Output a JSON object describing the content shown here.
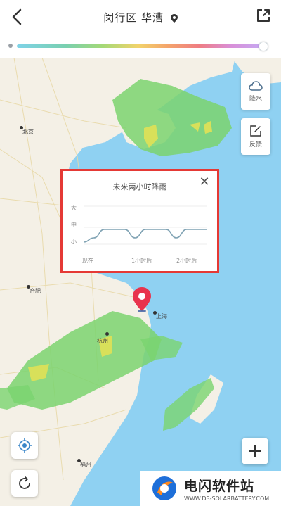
{
  "header": {
    "title": "闵行区 华漕",
    "back_icon": "chevron-left-icon",
    "share_icon": "share-icon",
    "location_icon": "location-pin-icon"
  },
  "timeline": {
    "handle_icon": "timeline-handle-icon"
  },
  "side_buttons": [
    {
      "label": "降水",
      "icon": "cloud-icon"
    },
    {
      "label": "反馈",
      "icon": "edit-icon"
    }
  ],
  "popup": {
    "title": "未来两小时降雨",
    "close_icon": "close-icon",
    "y_ticks": [
      "大",
      "中",
      "小"
    ],
    "x_ticks": [
      "现在",
      "1小时后",
      "2小时后"
    ]
  },
  "chart_data": {
    "type": "line",
    "title": "未来两小时降雨",
    "categories": [
      "现在",
      "1小时后",
      "2小时后"
    ],
    "y_categories": [
      "小",
      "中",
      "大"
    ],
    "x": [
      0,
      10,
      20,
      30,
      40,
      50,
      60,
      70,
      80,
      90,
      100,
      110,
      120
    ],
    "values": [
      0.15,
      0.25,
      0.45,
      0.45,
      0.45,
      0.25,
      0.45,
      0.45,
      0.45,
      0.25,
      0.45,
      0.45,
      0.45
    ],
    "grid": true
  },
  "map": {
    "cities": [
      "北京",
      "合肥",
      "上海",
      "杭州",
      "福州"
    ],
    "zoom_in_icon": "plus-icon",
    "locate_icon": "locate-icon",
    "refresh_icon": "refresh-icon",
    "marker_icon": "location-marker-icon"
  },
  "watermark": {
    "name": "电闪软件站",
    "url": "WWW.DS-SOLARBATTERY.COM"
  },
  "colors": {
    "sea": "#8fd1f2",
    "land": "#f4f0e6",
    "rain_light": "#7bd46f",
    "rain_heavy": "#d8e05a",
    "marker": "#e8344d",
    "popup_border": "#e53935",
    "curve": "#7fa2b3"
  }
}
